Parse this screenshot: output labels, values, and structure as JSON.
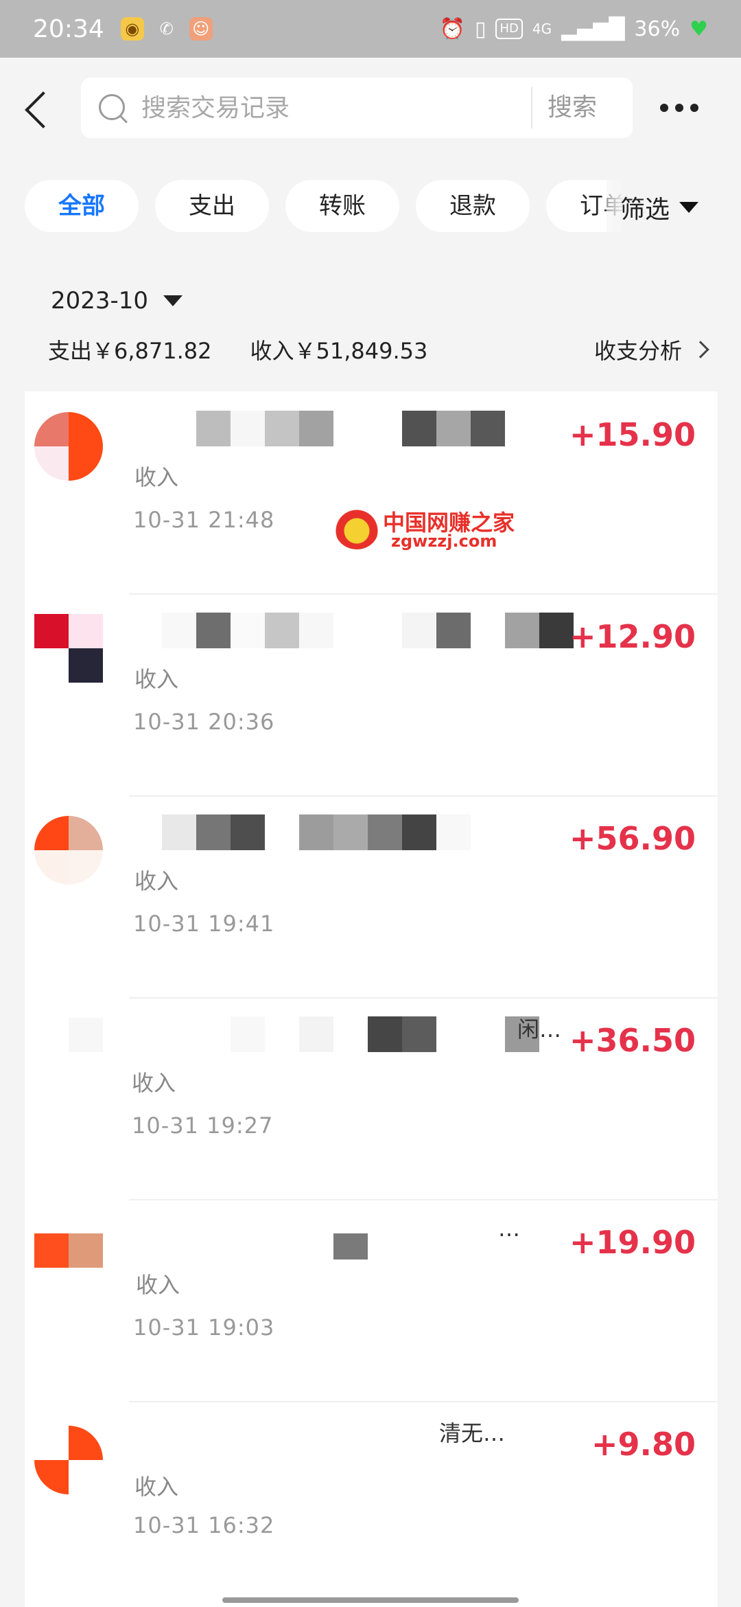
{
  "status_bar": {
    "time": "20:34",
    "network": "4G",
    "hd": "HD",
    "battery": "36%",
    "icons": [
      "app-icon-a",
      "phone-icon",
      "app-icon-b",
      "alarm-icon",
      "vibrate-icon",
      "signal-icon",
      "heart-icon"
    ]
  },
  "header": {
    "search_placeholder": "搜索交易记录",
    "search_button": "搜索"
  },
  "tabs": {
    "items": [
      "全部",
      "支出",
      "转账",
      "退款",
      "订单"
    ],
    "active_index": 0,
    "filter_label": "筛选"
  },
  "summary": {
    "month": "2023-10",
    "expense": "支出￥6,871.82",
    "income": "收入￥51,849.53",
    "analysis_label": "收支分析"
  },
  "watermark": {
    "cn": "中国网赚之家",
    "en": "zgwzzj.com"
  },
  "transactions": [
    {
      "title_visible": "",
      "label": "收入",
      "time": "10-31 21:48",
      "amount": "+15.90"
    },
    {
      "title_visible": "",
      "label": "收入",
      "time": "10-31 20:36",
      "amount": "+12.90"
    },
    {
      "title_visible": "",
      "label": "收入",
      "time": "10-31 19:41",
      "amount": "+56.90"
    },
    {
      "title_visible": "闲…",
      "label": "收入",
      "time": "10-31 19:27",
      "amount": "+36.50"
    },
    {
      "title_visible": "…",
      "label": "收入",
      "time": "10-31 19:03",
      "amount": "+19.90"
    },
    {
      "title_visible": "清无…",
      "label": "收入",
      "time": "10-31 16:32",
      "amount": "+9.80"
    }
  ],
  "colors": {
    "accent": "#1677ff",
    "income_amount": "#e5324a",
    "status_bar_bg": "#b9b9b9",
    "page_bg": "#f4f4f4"
  }
}
